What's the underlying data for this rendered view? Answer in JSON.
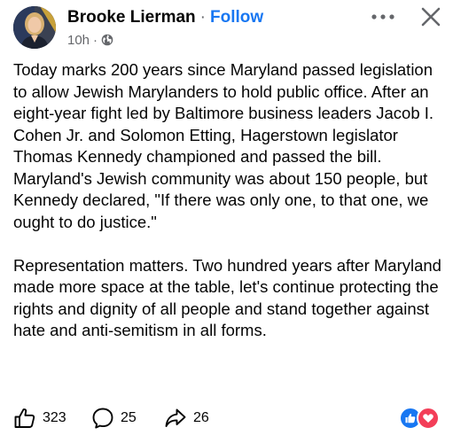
{
  "header": {
    "author_name": "Brooke Lierman",
    "separator": "·",
    "follow_label": "Follow",
    "timestamp": "10h",
    "meta_separator": "·",
    "audience_icon": "globe-icon",
    "more_icon": "more-dots-icon",
    "close_icon": "close-icon"
  },
  "post": {
    "paragraphs": [
      "Today marks 200 years since Maryland passed legislation to allow Jewish Marylanders to hold public office. After an eight-year fight led by Baltimore business leaders Jacob I. Cohen Jr. and Solomon Etting, Hagerstown legislator Thomas Kennedy championed and passed the bill. Maryland's Jewish community was about 150 people, but Kennedy declared, \"If there was only one, to that one, we ought to do justice.\"",
      "Representation matters. Two hundred years after Maryland made more space at the table, let's continue protecting the rights and dignity of all people and stand together against hate and anti-semitism in all forms."
    ]
  },
  "footer": {
    "like_count": "323",
    "comment_count": "25",
    "share_count": "26",
    "like_icon": "thumbs-up-icon",
    "comment_icon": "comment-bubble-icon",
    "share_icon": "share-arrow-icon",
    "reactions": [
      "like-reaction-icon",
      "love-reaction-icon"
    ]
  },
  "colors": {
    "text": "#050505",
    "secondary": "#65676b",
    "link_blue": "#1877f2",
    "love_red": "#f33e58"
  }
}
